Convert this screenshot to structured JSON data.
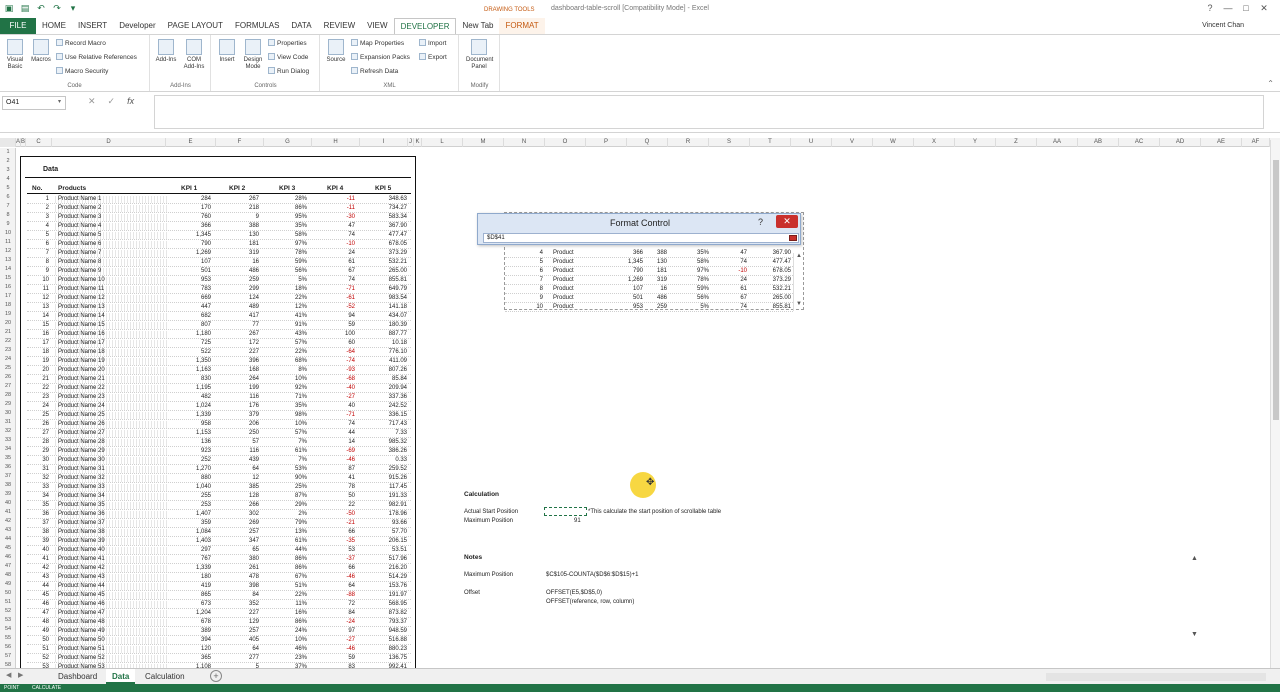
{
  "titlebar": {
    "drawing_tools": "DRAWING TOOLS",
    "title": "dashboard-table-scroll [Compatibility Mode] - Excel",
    "help": "?",
    "min": "—",
    "max": "□",
    "close": "✕"
  },
  "tabs": [
    {
      "label": "FILE"
    },
    {
      "label": "HOME"
    },
    {
      "label": "INSERT"
    },
    {
      "label": "Developer"
    },
    {
      "label": "PAGE LAYOUT"
    },
    {
      "label": "FORMULAS"
    },
    {
      "label": "DATA"
    },
    {
      "label": "REVIEW"
    },
    {
      "label": "VIEW"
    },
    {
      "label": "DEVELOPER"
    },
    {
      "label": "New Tab"
    },
    {
      "label": "FORMAT"
    }
  ],
  "user": "Vincent Chan",
  "ribbon": {
    "code": {
      "label": "Code",
      "visual_basic": "Visual Basic",
      "macros": "Macros",
      "record_macro": "Record Macro",
      "relative_refs": "Use Relative References",
      "macro_security": "Macro Security"
    },
    "addins": {
      "label": "Add-Ins",
      "addins": "Add-Ins",
      "com_addins": "COM Add-Ins"
    },
    "controls": {
      "label": "Controls",
      "insert": "Insert",
      "design_mode": "Design Mode",
      "properties": "Properties",
      "view_code": "View Code",
      "run_dialog": "Run Dialog"
    },
    "xml": {
      "label": "XML",
      "source": "Source",
      "map_properties": "Map Properties",
      "expansion_packs": "Expansion Packs",
      "refresh_data": "Refresh Data",
      "import": "Import",
      "export": "Export"
    },
    "modify": {
      "label": "Modify",
      "document_panel": "Document Panel"
    }
  },
  "formula_bar": {
    "name_box": "O41",
    "fx": "fx",
    "value": ""
  },
  "columns": [
    "A",
    "B",
    "C",
    "D",
    "E",
    "F",
    "G",
    "H",
    "I",
    "J",
    "K",
    "L",
    "M",
    "N",
    "O",
    "P",
    "Q",
    "R",
    "S",
    "T",
    "U",
    "V",
    "W",
    "X",
    "Y",
    "Z",
    "AA",
    "AB",
    "AC",
    "AD",
    "AE",
    "AF"
  ],
  "rows": [
    "1",
    "2",
    "3",
    "4",
    "5",
    "6",
    "7",
    "8",
    "9",
    "10",
    "11",
    "12",
    "13",
    "14",
    "15",
    "16",
    "17",
    "18",
    "19",
    "20",
    "21",
    "22",
    "23",
    "24",
    "25",
    "26",
    "27",
    "28",
    "29",
    "30",
    "31",
    "32",
    "33",
    "34",
    "35",
    "36",
    "37",
    "38",
    "39",
    "40",
    "41",
    "42",
    "43",
    "44",
    "45",
    "46",
    "47",
    "48",
    "49",
    "50",
    "51",
    "52",
    "53",
    "54",
    "55",
    "56",
    "57",
    "58"
  ],
  "data_sheet": {
    "title": "Data",
    "headers": [
      "No.",
      "Products",
      "KPI 1",
      "KPI 2",
      "KPI 3",
      "KPI 4",
      "KPI 5"
    ],
    "rows": [
      [
        "1",
        "Product Name 1",
        "284",
        "267",
        "28%",
        "-11",
        "348.63"
      ],
      [
        "2",
        "Product Name 2",
        "170",
        "218",
        "86%",
        "-11",
        "734.27"
      ],
      [
        "3",
        "Product Name 3",
        "760",
        "9",
        "95%",
        "-30",
        "583.34"
      ],
      [
        "4",
        "Product Name 4",
        "366",
        "388",
        "35%",
        "47",
        "367.90"
      ],
      [
        "5",
        "Product Name 5",
        "1,345",
        "130",
        "58%",
        "74",
        "477.47"
      ],
      [
        "6",
        "Product Name 6",
        "790",
        "181",
        "97%",
        "-10",
        "678.05"
      ],
      [
        "7",
        "Product Name 7",
        "1,269",
        "319",
        "78%",
        "24",
        "373.29"
      ],
      [
        "8",
        "Product Name 8",
        "107",
        "16",
        "59%",
        "61",
        "532.21"
      ],
      [
        "9",
        "Product Name 9",
        "501",
        "486",
        "56%",
        "67",
        "265.00"
      ],
      [
        "10",
        "Product Name 10",
        "953",
        "259",
        "5%",
        "74",
        "855.81"
      ],
      [
        "11",
        "Product Name 11",
        "783",
        "299",
        "18%",
        "-71",
        "649.79"
      ],
      [
        "12",
        "Product Name 12",
        "669",
        "124",
        "22%",
        "-61",
        "983.54"
      ],
      [
        "13",
        "Product Name 13",
        "447",
        "489",
        "12%",
        "-52",
        "141.18"
      ],
      [
        "14",
        "Product Name 14",
        "682",
        "417",
        "41%",
        "94",
        "434.07"
      ],
      [
        "15",
        "Product Name 15",
        "807",
        "77",
        "91%",
        "59",
        "180.39"
      ],
      [
        "16",
        "Product Name 16",
        "1,180",
        "267",
        "43%",
        "100",
        "887.77"
      ],
      [
        "17",
        "Product Name 17",
        "725",
        "172",
        "57%",
        "60",
        "10.18"
      ],
      [
        "18",
        "Product Name 18",
        "522",
        "227",
        "22%",
        "-64",
        "776.10"
      ],
      [
        "19",
        "Product Name 19",
        "1,350",
        "396",
        "68%",
        "-74",
        "411.09"
      ],
      [
        "20",
        "Product Name 20",
        "1,163",
        "168",
        "8%",
        "-93",
        "807.26"
      ],
      [
        "21",
        "Product Name 21",
        "830",
        "264",
        "10%",
        "-68",
        "85.84"
      ],
      [
        "22",
        "Product Name 22",
        "1,195",
        "199",
        "92%",
        "-40",
        "209.94"
      ],
      [
        "23",
        "Product Name 23",
        "482",
        "116",
        "71%",
        "-27",
        "337.36"
      ],
      [
        "24",
        "Product Name 24",
        "1,024",
        "176",
        "35%",
        "40",
        "242.52"
      ],
      [
        "25",
        "Product Name 25",
        "1,339",
        "379",
        "98%",
        "-71",
        "336.15"
      ],
      [
        "26",
        "Product Name 26",
        "958",
        "206",
        "10%",
        "74",
        "717.43"
      ],
      [
        "27",
        "Product Name 27",
        "1,153",
        "250",
        "57%",
        "44",
        "7.33"
      ],
      [
        "28",
        "Product Name 28",
        "136",
        "57",
        "7%",
        "14",
        "985.32"
      ],
      [
        "29",
        "Product Name 29",
        "923",
        "116",
        "61%",
        "-69",
        "386.26"
      ],
      [
        "30",
        "Product Name 30",
        "252",
        "439",
        "7%",
        "-46",
        "0.33"
      ],
      [
        "31",
        "Product Name 31",
        "1,270",
        "64",
        "53%",
        "87",
        "259.52"
      ],
      [
        "32",
        "Product Name 32",
        "880",
        "12",
        "90%",
        "41",
        "915.26"
      ],
      [
        "33",
        "Product Name 33",
        "1,040",
        "385",
        "25%",
        "78",
        "117.45"
      ],
      [
        "34",
        "Product Name 34",
        "255",
        "128",
        "87%",
        "50",
        "191.33"
      ],
      [
        "35",
        "Product Name 35",
        "253",
        "266",
        "29%",
        "22",
        "982.91"
      ],
      [
        "36",
        "Product Name 36",
        "1,407",
        "302",
        "2%",
        "-50",
        "178.96"
      ],
      [
        "37",
        "Product Name 37",
        "359",
        "269",
        "79%",
        "-21",
        "93.66"
      ],
      [
        "38",
        "Product Name 38",
        "1,084",
        "257",
        "13%",
        "66",
        "57.70"
      ],
      [
        "39",
        "Product Name 39",
        "1,403",
        "347",
        "61%",
        "-35",
        "206.15"
      ],
      [
        "40",
        "Product Name 40",
        "297",
        "65",
        "44%",
        "53",
        "53.51"
      ],
      [
        "41",
        "Product Name 41",
        "767",
        "380",
        "86%",
        "-37",
        "517.96"
      ],
      [
        "42",
        "Product Name 42",
        "1,339",
        "261",
        "86%",
        "66",
        "216.20"
      ],
      [
        "43",
        "Product Name 43",
        "180",
        "478",
        "67%",
        "-46",
        "514.29"
      ],
      [
        "44",
        "Product Name 44",
        "419",
        "398",
        "51%",
        "64",
        "153.76"
      ],
      [
        "45",
        "Product Name 45",
        "865",
        "84",
        "22%",
        "-88",
        "191.97"
      ],
      [
        "46",
        "Product Name 46",
        "673",
        "352",
        "11%",
        "72",
        "568.95"
      ],
      [
        "47",
        "Product Name 47",
        "1,204",
        "227",
        "16%",
        "84",
        "873.82"
      ],
      [
        "48",
        "Product Name 48",
        "678",
        "129",
        "86%",
        "-24",
        "793.37"
      ],
      [
        "49",
        "Product Name 49",
        "389",
        "257",
        "24%",
        "97",
        "948.59"
      ],
      [
        "50",
        "Product Name 50",
        "394",
        "405",
        "10%",
        "-27",
        "516.88"
      ],
      [
        "51",
        "Product Name 51",
        "120",
        "64",
        "46%",
        "-46",
        "880.23"
      ],
      [
        "52",
        "Product Name 52",
        "365",
        "277",
        "23%",
        "59",
        "136.75"
      ],
      [
        "53",
        "Product Name 53",
        "1,108",
        "5",
        "37%",
        "83",
        "992.41"
      ]
    ]
  },
  "preview": {
    "rows": [
      [
        "4",
        "Product",
        "366",
        "388",
        "35%",
        "47",
        "367.90"
      ],
      [
        "5",
        "Product",
        "1,345",
        "130",
        "58%",
        "74",
        "477.47"
      ],
      [
        "6",
        "Product",
        "790",
        "181",
        "97%",
        "-10",
        "678.05"
      ],
      [
        "7",
        "Product",
        "1,269",
        "319",
        "78%",
        "24",
        "373.29"
      ],
      [
        "8",
        "Product",
        "107",
        "16",
        "59%",
        "61",
        "532.21"
      ],
      [
        "9",
        "Product",
        "501",
        "486",
        "56%",
        "67",
        "265.00"
      ],
      [
        "10",
        "Product",
        "953",
        "259",
        "5%",
        "74",
        "855.81"
      ]
    ],
    "scroll_up": "▲",
    "scroll_down": "▼"
  },
  "dialog": {
    "title": "Format Control",
    "help": "?",
    "close": "✕",
    "cell_ref": "$D$41"
  },
  "calculation": {
    "heading": "Calculation",
    "actual_start_label": "Actual Start Position",
    "actual_start_note": "*This calculate the start position of scrollable table",
    "maximum_label": "Maximum Position",
    "maximum_value": "91",
    "notes_heading": "Notes",
    "notes_max_label": "Maximum Position",
    "notes_max_formula": "$C$105-COUNTA($D$6:$D$15)+1",
    "offset_label": "Offset",
    "offset_example": "OFFSET(E5,$D$5,0)",
    "offset_syntax": "OFFSET(reference, row, column)"
  },
  "sheets": [
    {
      "label": "Dashboard",
      "active": false
    },
    {
      "label": "Data",
      "active": true
    },
    {
      "label": "Calculation",
      "active": false
    }
  ],
  "add_sheet": "+",
  "status": {
    "left1": "POINT",
    "left2": "CALCULATE"
  },
  "colors": {
    "accent": "#217346",
    "negative": "#c00000",
    "format_tab": "#c55a11",
    "dialog_close": "#c9302c"
  }
}
